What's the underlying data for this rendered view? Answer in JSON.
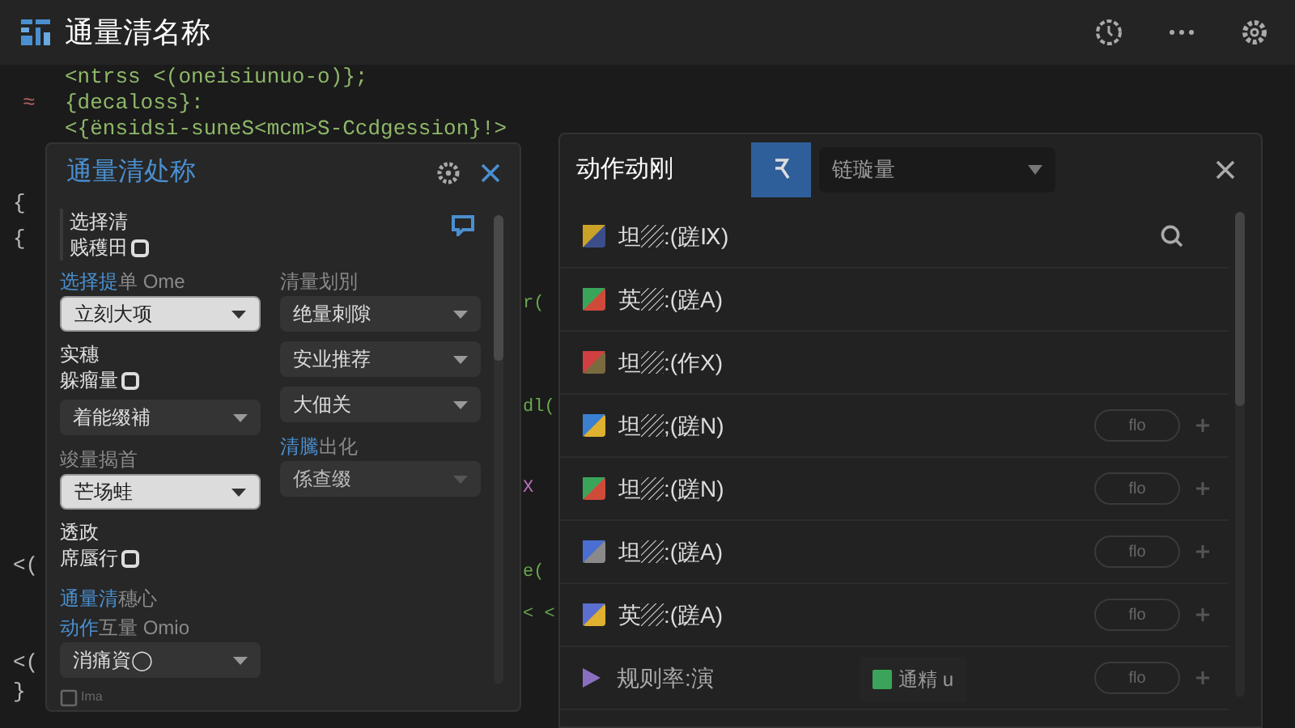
{
  "window": {
    "title": "通量清名称"
  },
  "code_lines": [
    {
      "text": "<ntrss <(oneisiunuo-o)};"
    },
    {
      "gutter": "≈",
      "text": "{decaloss}:"
    },
    {
      "text": "<{ënsidsi-suneS<mcm>S-Ccdgession}!>"
    }
  ],
  "gutter_marks": [
    "{",
    "{",
    "<(",
    "<(",
    "}"
  ],
  "code_fragments": [
    "r(",
    "dl(",
    "X",
    "e(",
    "< <"
  ],
  "settings_panel": {
    "title": "通量清处称",
    "top_check": {
      "caption": "选择清",
      "label": "贱穫田",
      "checked": false
    },
    "left_column": [
      {
        "kind": "label",
        "parts": [
          {
            "text": "选择提",
            "accent": true
          },
          {
            "text": "单 Ome",
            "accent": false
          }
        ]
      },
      {
        "kind": "select",
        "value": "立刻大项",
        "highlighted": true
      },
      {
        "kind": "checkbox",
        "caption": "实穗",
        "label": "躲瘤量",
        "checked": false
      },
      {
        "kind": "select",
        "value": "着能缀補",
        "highlighted": false
      },
      {
        "kind": "label",
        "parts": [
          {
            "text": "竣量揭首",
            "accent": false
          }
        ]
      },
      {
        "kind": "select",
        "value": "芒场蛙",
        "highlighted": true
      },
      {
        "kind": "checkbox",
        "caption": "透政",
        "label": "席蜃行",
        "checked": false
      }
    ],
    "right_column": [
      {
        "kind": "label",
        "parts": [
          {
            "text": "清量划別",
            "accent": false
          }
        ]
      },
      {
        "kind": "select",
        "value": "绝量刺隙",
        "highlighted": false
      },
      {
        "kind": "select",
        "value": "安业推荐",
        "highlighted": false
      },
      {
        "kind": "select",
        "value": "大佃关",
        "highlighted": false
      },
      {
        "kind": "label",
        "parts": [
          {
            "text": "清騰",
            "accent": true
          },
          {
            "text": "出化",
            "accent": false
          }
        ]
      },
      {
        "kind": "select",
        "value": "係查缀",
        "highlighted": false,
        "disabled": true
      }
    ],
    "bottom": [
      {
        "kind": "label",
        "parts": [
          {
            "text": "通量清",
            "accent": true
          },
          {
            "text": "穗心",
            "accent": false
          }
        ]
      },
      {
        "kind": "label",
        "parts": [
          {
            "text": "动作",
            "accent": true
          },
          {
            "text": "互量 Omio",
            "accent": false
          }
        ]
      },
      {
        "kind": "select",
        "value": "消痛資◯",
        "highlighted": false
      }
    ],
    "footer": "Ima"
  },
  "actions_panel": {
    "title": "动作动刚",
    "filter": "链璇量",
    "rows": [
      {
        "kind": "item",
        "label": "坦▨:(蹉Ⅸ)",
        "search": true
      },
      {
        "kind": "item",
        "label": "英▨:(蹉A)"
      },
      {
        "kind": "item",
        "label": "坦▨:(作X)"
      },
      {
        "kind": "item",
        "label": "坦▨;(蹉N)",
        "action": "flo"
      },
      {
        "kind": "item",
        "label": "坦▨:(蹉N)",
        "action": "flo"
      },
      {
        "kind": "item",
        "label": "坦▨:(蹉A)",
        "action": "flo"
      },
      {
        "kind": "item",
        "label": "英▨:(蹉A)",
        "action": "flo"
      },
      {
        "kind": "rule",
        "label": "规则率:演",
        "action": "flo",
        "tag": "通精 u"
      }
    ]
  }
}
